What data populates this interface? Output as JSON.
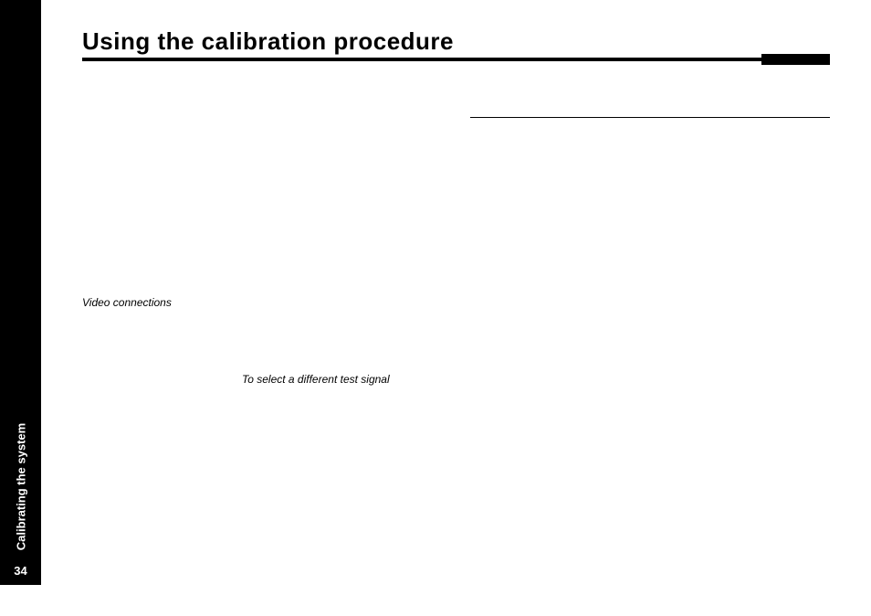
{
  "sidebar": {
    "chapter_label": "Calibrating the system",
    "page_number": "34"
  },
  "header": {
    "title": "Using the calibration procedure"
  },
  "body": {
    "caption_video": "Video connections",
    "caption_select": "To select a different test signal"
  }
}
